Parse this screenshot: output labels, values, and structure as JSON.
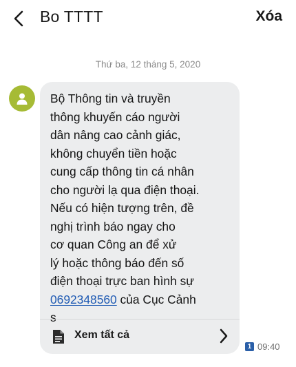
{
  "header": {
    "back_icon": "arrow-left-icon",
    "title": "Bo TTTT",
    "delete_label": "Xóa"
  },
  "conversation": {
    "date_separator": "Thứ ba, 12 tháng 5, 2020",
    "avatar_icon": "person-icon",
    "avatar_color": "#a6bb35",
    "bubble_color": "#ecedee",
    "message": {
      "text_before_phone": "Bộ Thông tin và truyền\nthông khuyến cáo người\ndân nâng cao cảnh giác,\nkhông chuyển tiền hoặc\ncung cấp thông tin cá nhân\ncho người lạ qua điện thoại.\nNếu có hiện tượng trên, đề\nnghị trình báo ngay cho\ncơ quan Công an để xử\nlý hoặc thông báo đến số\nđiện thoại trực ban hình sự\n",
      "phone_number": "0692348560",
      "text_after_phone": " của Cục Cảnh\ns",
      "link_color": "#1f5ab3"
    },
    "see_all": {
      "icon": "document-icon",
      "label": "Xem tất cả",
      "chevron_icon": "chevron-right-icon"
    },
    "sim_badge": "1",
    "sim_badge_color": "#2a5fa8",
    "time": "09:40"
  }
}
